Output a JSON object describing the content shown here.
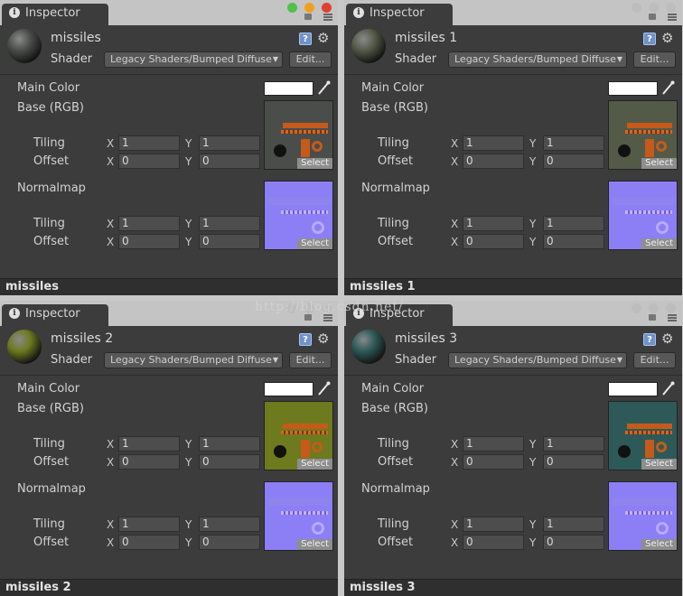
{
  "tab_label": "Inspector",
  "shader_label": "Shader",
  "shader_value": "Legacy Shaders/Bumped Diffuse",
  "edit_label": "Edit...",
  "main_color_label": "Main Color",
  "main_color_value": "#ffffff",
  "base_label": "Base (RGB)",
  "normalmap_label": "Normalmap",
  "tiling_label": "Tiling",
  "offset_label": "Offset",
  "x_label": "X",
  "y_label": "Y",
  "select_label": "Select",
  "help_icon_glyph": "?",
  "tab_icon_glyph": "i",
  "watermark": "http://blog.csdn.net/",
  "panels": [
    {
      "name": "missiles",
      "footer": "missiles",
      "tint": "#4a4d4a",
      "active": true,
      "base_tiling": {
        "x": "1",
        "y": "1"
      },
      "base_offset": {
        "x": "0",
        "y": "0"
      },
      "normal_tiling": {
        "x": "1",
        "y": "1"
      },
      "normal_offset": {
        "x": "0",
        "y": "0"
      }
    },
    {
      "name": "missiles 1",
      "footer": "missiles 1",
      "tint": "#545a48",
      "active": false,
      "base_tiling": {
        "x": "1",
        "y": "1"
      },
      "base_offset": {
        "x": "0",
        "y": "0"
      },
      "normal_tiling": {
        "x": "1",
        "y": "1"
      },
      "normal_offset": {
        "x": "0",
        "y": "0"
      }
    },
    {
      "name": "missiles 2",
      "footer": "missiles 2",
      "tint": "#6d7a1e",
      "active": false,
      "base_tiling": {
        "x": "1",
        "y": "1"
      },
      "base_offset": {
        "x": "0",
        "y": "0"
      },
      "normal_tiling": {
        "x": "1",
        "y": "1"
      },
      "normal_offset": {
        "x": "0",
        "y": "0"
      }
    },
    {
      "name": "missiles 3",
      "footer": "missiles 3",
      "tint": "#2d5a58",
      "active": false,
      "base_tiling": {
        "x": "1",
        "y": "1"
      },
      "base_offset": {
        "x": "0",
        "y": "0"
      },
      "normal_tiling": {
        "x": "1",
        "y": "1"
      },
      "normal_offset": {
        "x": "0",
        "y": "0"
      }
    }
  ],
  "colors": {
    "panel_bg": "#3c3c3c",
    "normal_map": "#8c7ef5",
    "accent_orange": "#c55a1a",
    "close_red": "#e04030",
    "min_orange": "#f0a020",
    "max_green": "#4fc04a"
  },
  "icons": [
    "info-icon",
    "lock-icon",
    "menu-icon",
    "help-icon",
    "gear-icon",
    "eyedropper-icon"
  ]
}
